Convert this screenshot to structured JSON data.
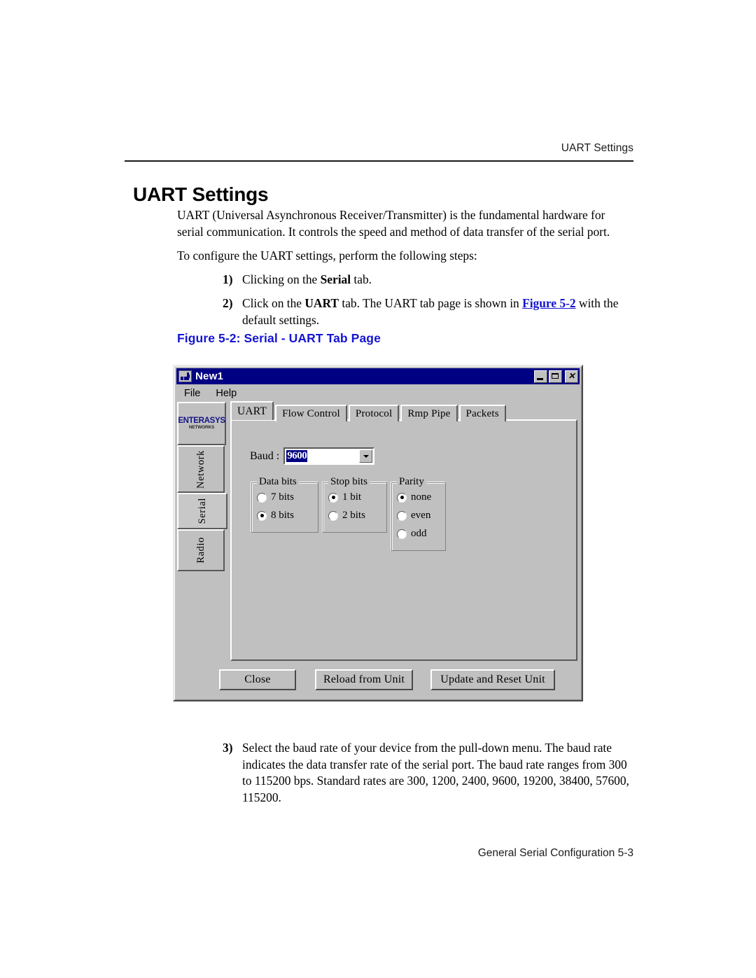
{
  "page": {
    "running_header": "UART Settings",
    "section_title": "UART Settings",
    "footer": "General Serial Configuration 5-3",
    "paragraphs": {
      "intro": "UART (Universal Asynchronous Receiver/Transmitter) is the fundamental hardware for serial communication. It controls the speed and method of data transfer of the serial port.",
      "steps_lead": "To configure the UART settings, perform the following steps:"
    },
    "steps": [
      {
        "number": "1)",
        "text_before": "Clicking on the ",
        "bold": "Serial",
        "text_after": " tab."
      },
      {
        "number": "2)",
        "text_before": "Click on the ",
        "bold": "UART",
        "text_mid": " tab. The UART tab page is shown in ",
        "link": "Figure 5-2",
        "text_after": " with the default settings."
      },
      {
        "number": "3)",
        "text": "Select the baud rate of your device from the pull-down menu. The baud rate indicates the data transfer rate of the serial port. The baud rate ranges from 300 to 115200 bps. Standard rates are 300, 1200, 2400, 9600, 19200, 38400, 57600, 115200."
      }
    ],
    "figure_caption": "Figure  5-2: Serial - UART Tab Page",
    "colors": {
      "link_blue": "#1414d2",
      "titlebar_blue": "#000083",
      "dialog_face": "#c0c0c0",
      "selection_blue": "#000083"
    }
  },
  "dialog": {
    "title": "New1",
    "title_icon": "application-icon",
    "window_buttons": {
      "minimize": "minimize-icon",
      "maximize": "maximize-icon",
      "close": "close-icon"
    },
    "menu": [
      {
        "label": "File"
      },
      {
        "label": "Help"
      }
    ],
    "vertical_tabs": {
      "logo_main": "ENTERASYS",
      "logo_sub": "NETWORKS",
      "items": [
        {
          "label": "Network",
          "selected": false
        },
        {
          "label": "Serial",
          "selected": true
        },
        {
          "label": "Radio",
          "selected": false
        }
      ]
    },
    "tabs": [
      {
        "label": "UART",
        "active": true
      },
      {
        "label": "Flow Control",
        "active": false
      },
      {
        "label": "Protocol",
        "active": false
      },
      {
        "label": "Rmp Pipe",
        "active": false
      },
      {
        "label": "Packets",
        "active": false
      }
    ],
    "uart_page": {
      "baud": {
        "label": "Baud :",
        "value": "9600",
        "dropdown_icon": "chevron-down-icon",
        "options": [
          "300",
          "1200",
          "2400",
          "9600",
          "19200",
          "38400",
          "57600",
          "115200"
        ]
      },
      "groups": [
        {
          "title": "Data bits",
          "options": [
            {
              "label": "7 bits",
              "selected": false
            },
            {
              "label": "8 bits",
              "selected": true
            }
          ]
        },
        {
          "title": "Stop bits",
          "options": [
            {
              "label": "1 bit",
              "selected": true
            },
            {
              "label": "2 bits",
              "selected": false
            }
          ]
        },
        {
          "title": "Parity",
          "options": [
            {
              "label": "none",
              "selected": true
            },
            {
              "label": "even",
              "selected": false
            },
            {
              "label": "odd",
              "selected": false
            }
          ]
        }
      ]
    },
    "buttons": [
      {
        "label": "Close"
      },
      {
        "label": "Reload from Unit"
      },
      {
        "label": "Update and Reset Unit"
      }
    ]
  }
}
